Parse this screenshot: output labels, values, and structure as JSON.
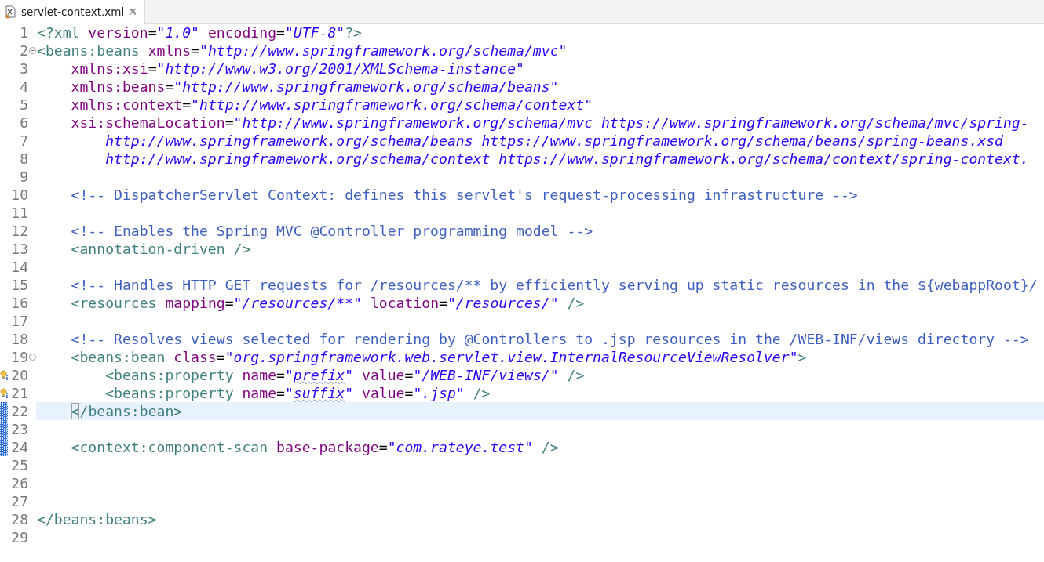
{
  "tabs": [
    {
      "label": "servlet-context.xml",
      "selected": true
    }
  ],
  "editor": {
    "lines": [
      {
        "number": "1",
        "kind": "plain",
        "current": false,
        "changed": false,
        "tokens": [
          {
            "kind": "tag",
            "t": "<?xml"
          },
          {
            "kind": "attr",
            "t": " version"
          },
          {
            "kind": "plain",
            "t": "="
          },
          {
            "kind": "value",
            "t": "\"1.0\""
          },
          {
            "kind": "attr",
            "t": " encoding"
          },
          {
            "kind": "plain",
            "t": "="
          },
          {
            "kind": "value",
            "t": "\"UTF-8\""
          },
          {
            "kind": "tag",
            "t": "?>"
          }
        ]
      },
      {
        "number": "2",
        "kind": "fold",
        "current": false,
        "changed": false,
        "tokens": [
          {
            "kind": "tag",
            "t": "<beans:beans"
          },
          {
            "kind": "attr",
            "t": " xmlns"
          },
          {
            "kind": "plain",
            "t": "="
          },
          {
            "kind": "value",
            "t": "\"http://www.springframework.org/schema/mvc\""
          }
        ]
      },
      {
        "number": "3",
        "kind": "plain",
        "current": false,
        "changed": false,
        "tokens": [
          {
            "kind": "attr",
            "t": "    xmlns:xsi"
          },
          {
            "kind": "plain",
            "t": "="
          },
          {
            "kind": "value",
            "t": "\"http://www.w3.org/2001/XMLSchema-instance\""
          }
        ]
      },
      {
        "number": "4",
        "kind": "plain",
        "current": false,
        "changed": false,
        "tokens": [
          {
            "kind": "attr",
            "t": "    xmlns:beans"
          },
          {
            "kind": "plain",
            "t": "="
          },
          {
            "kind": "value",
            "t": "\"http://www.springframework.org/schema/beans\""
          }
        ]
      },
      {
        "number": "5",
        "kind": "plain",
        "current": false,
        "changed": false,
        "tokens": [
          {
            "kind": "attr",
            "t": "    xmlns:context"
          },
          {
            "kind": "plain",
            "t": "="
          },
          {
            "kind": "value",
            "t": "\"http://www.springframework.org/schema/context\""
          }
        ]
      },
      {
        "number": "6",
        "kind": "plain",
        "current": false,
        "changed": false,
        "tokens": [
          {
            "kind": "attr",
            "t": "    xsi:schemaLocation"
          },
          {
            "kind": "plain",
            "t": "="
          },
          {
            "kind": "value",
            "t": "\"http://www.springframework.org/schema/mvc https://www.springframework.org/schema/mvc/spring-"
          }
        ]
      },
      {
        "number": "7",
        "kind": "plain",
        "current": false,
        "changed": false,
        "tokens": [
          {
            "kind": "value",
            "t": "        http://www.springframework.org/schema/beans https://www.springframework.org/schema/beans/spring-beans.xsd"
          }
        ]
      },
      {
        "number": "8",
        "kind": "plain",
        "current": false,
        "changed": false,
        "tokens": [
          {
            "kind": "value",
            "t": "        http://www.springframework.org/schema/context https://www.springframework.org/schema/context/spring-context."
          }
        ]
      },
      {
        "number": "9",
        "kind": "plain",
        "current": false,
        "changed": false
      },
      {
        "number": "10",
        "kind": "plain",
        "current": false,
        "changed": false,
        "tokens": [
          {
            "kind": "comment",
            "t": "    <!-- DispatcherServlet Context: defines this servlet's request-processing infrastructure -->"
          }
        ]
      },
      {
        "number": "11",
        "kind": "plain",
        "current": false,
        "changed": false
      },
      {
        "number": "12",
        "kind": "plain",
        "current": false,
        "changed": false,
        "tokens": [
          {
            "kind": "comment",
            "t": "    <!-- Enables the Spring MVC @Controller programming model -->"
          }
        ]
      },
      {
        "number": "13",
        "kind": "plain",
        "current": false,
        "changed": false,
        "tokens": [
          {
            "kind": "tag",
            "t": "    <annotation-driven />"
          }
        ]
      },
      {
        "number": "14",
        "kind": "plain",
        "current": false,
        "changed": false
      },
      {
        "number": "15",
        "kind": "plain",
        "current": false,
        "changed": false,
        "tokens": [
          {
            "kind": "comment",
            "t": "    <!-- Handles HTTP GET requests for /resources/** by efficiently serving up static resources in the ${webappRoot}/"
          }
        ]
      },
      {
        "number": "16",
        "kind": "plain",
        "current": false,
        "changed": false,
        "tokens": [
          {
            "kind": "tag",
            "t": "    <resources"
          },
          {
            "kind": "attr",
            "t": " mapping"
          },
          {
            "kind": "plain",
            "t": "="
          },
          {
            "kind": "value",
            "t": "\"/resources/**\""
          },
          {
            "kind": "attr",
            "t": " location"
          },
          {
            "kind": "plain",
            "t": "="
          },
          {
            "kind": "value",
            "t": "\"/resources/\""
          },
          {
            "kind": "tag",
            "t": " />"
          }
        ]
      },
      {
        "number": "17",
        "kind": "plain",
        "current": false,
        "changed": false
      },
      {
        "number": "18",
        "kind": "plain",
        "current": false,
        "changed": false,
        "tokens": [
          {
            "kind": "comment",
            "t": "    <!-- Resolves views selected for rendering by @Controllers to .jsp resources in the /WEB-INF/views directory -->"
          }
        ]
      },
      {
        "number": "19",
        "kind": "fold",
        "current": false,
        "changed": false,
        "tokens": [
          {
            "kind": "tag",
            "t": "    <beans:bean"
          },
          {
            "kind": "attr",
            "t": " class"
          },
          {
            "kind": "plain",
            "t": "="
          },
          {
            "kind": "value",
            "t": "\"org.springframework.web.servlet.view.InternalResourceViewResolver\""
          },
          {
            "kind": "tag",
            "t": ">"
          }
        ]
      },
      {
        "number": "20",
        "kind": "warning",
        "current": false,
        "changed": false,
        "tokens": [
          {
            "kind": "tag",
            "t": "        <beans:property"
          },
          {
            "kind": "attr",
            "t": " name"
          },
          {
            "kind": "plain",
            "t": "="
          },
          {
            "kind": "value",
            "t": "\""
          },
          {
            "kind": "value",
            "t": "prefix",
            "misspelled": true
          },
          {
            "kind": "value",
            "t": "\""
          },
          {
            "kind": "attr",
            "t": " value"
          },
          {
            "kind": "plain",
            "t": "="
          },
          {
            "kind": "value",
            "t": "\"/WEB-INF/views/\""
          },
          {
            "kind": "tag",
            "t": " />"
          }
        ]
      },
      {
        "number": "21",
        "kind": "warning",
        "current": false,
        "changed": false,
        "tokens": [
          {
            "kind": "tag",
            "t": "        <beans:property"
          },
          {
            "kind": "attr",
            "t": " name"
          },
          {
            "kind": "plain",
            "t": "="
          },
          {
            "kind": "value",
            "t": "\""
          },
          {
            "kind": "value",
            "t": "suffix",
            "misspelled": true
          },
          {
            "kind": "value",
            "t": "\""
          },
          {
            "kind": "attr",
            "t": " value"
          },
          {
            "kind": "plain",
            "t": "="
          },
          {
            "kind": "value",
            "t": "\".jsp\""
          },
          {
            "kind": "tag",
            "t": " />"
          }
        ]
      },
      {
        "number": "22",
        "kind": "plain",
        "current": true,
        "changed": true,
        "tokens": [
          {
            "kind": "tag",
            "t": "    <",
            "matched": true
          },
          {
            "kind": "tag",
            "t": "/beans:bean>"
          }
        ]
      },
      {
        "number": "23",
        "kind": "plain",
        "current": false,
        "changed": true
      },
      {
        "number": "24",
        "kind": "plain",
        "current": false,
        "changed": true,
        "tokens": [
          {
            "kind": "tag",
            "t": "    <context:component-scan"
          },
          {
            "kind": "attr",
            "t": " base-package"
          },
          {
            "kind": "plain",
            "t": "="
          },
          {
            "kind": "value",
            "t": "\"com.rateye.test\""
          },
          {
            "kind": "tag",
            "t": " />"
          }
        ]
      },
      {
        "number": "25",
        "kind": "plain",
        "current": false,
        "changed": false
      },
      {
        "number": "26",
        "kind": "plain",
        "current": false,
        "changed": false
      },
      {
        "number": "27",
        "kind": "plain",
        "current": false,
        "changed": false
      },
      {
        "number": "28",
        "kind": "plain",
        "current": false,
        "changed": false,
        "tokens": [
          {
            "kind": "tag",
            "t": "</beans:beans>"
          }
        ]
      },
      {
        "number": "29",
        "kind": "plain",
        "current": false,
        "changed": false
      }
    ]
  }
}
